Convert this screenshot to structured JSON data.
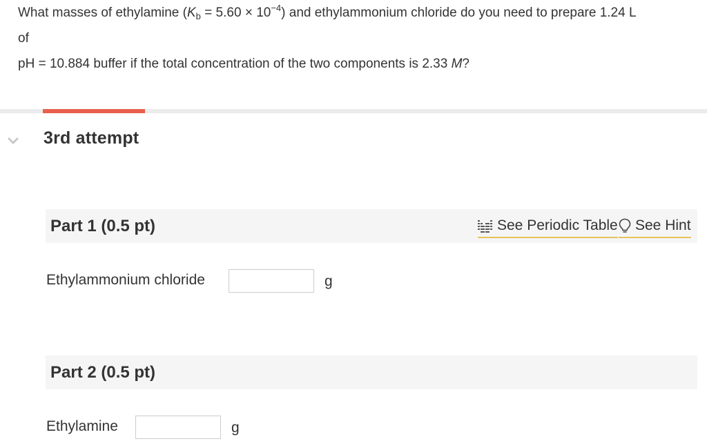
{
  "question": {
    "line1_a": "What masses of ethylamine (",
    "kb_symbol": "K",
    "kb_sub": "b",
    "kb_value": " = 5.60 × 10",
    "kb_exp": "−4",
    "line1_b": ") and ethylammonium chloride do you need to prepare 1.24 L",
    "line2": "of",
    "line3_a": "pH = 10.884 buffer if the total concentration of the two components is 2.33 ",
    "molar_unit": "M",
    "line3_b": "?"
  },
  "attempt": {
    "title": "3rd attempt",
    "progress_color": "#e8604c"
  },
  "tools": {
    "periodic_table": "See Periodic Table",
    "hint": "See Hint"
  },
  "parts": [
    {
      "title": "Part 1 (0.5 pt)",
      "label": "Ethylammonium chloride",
      "value": "",
      "unit": "g"
    },
    {
      "title": "Part 2 (0.5 pt)",
      "label": "Ethylamine",
      "value": "",
      "unit": "g"
    }
  ],
  "icons": {
    "collapse": "chevron-down-icon",
    "periodic": "periodic-table-icon",
    "hint": "lightbulb-icon"
  }
}
